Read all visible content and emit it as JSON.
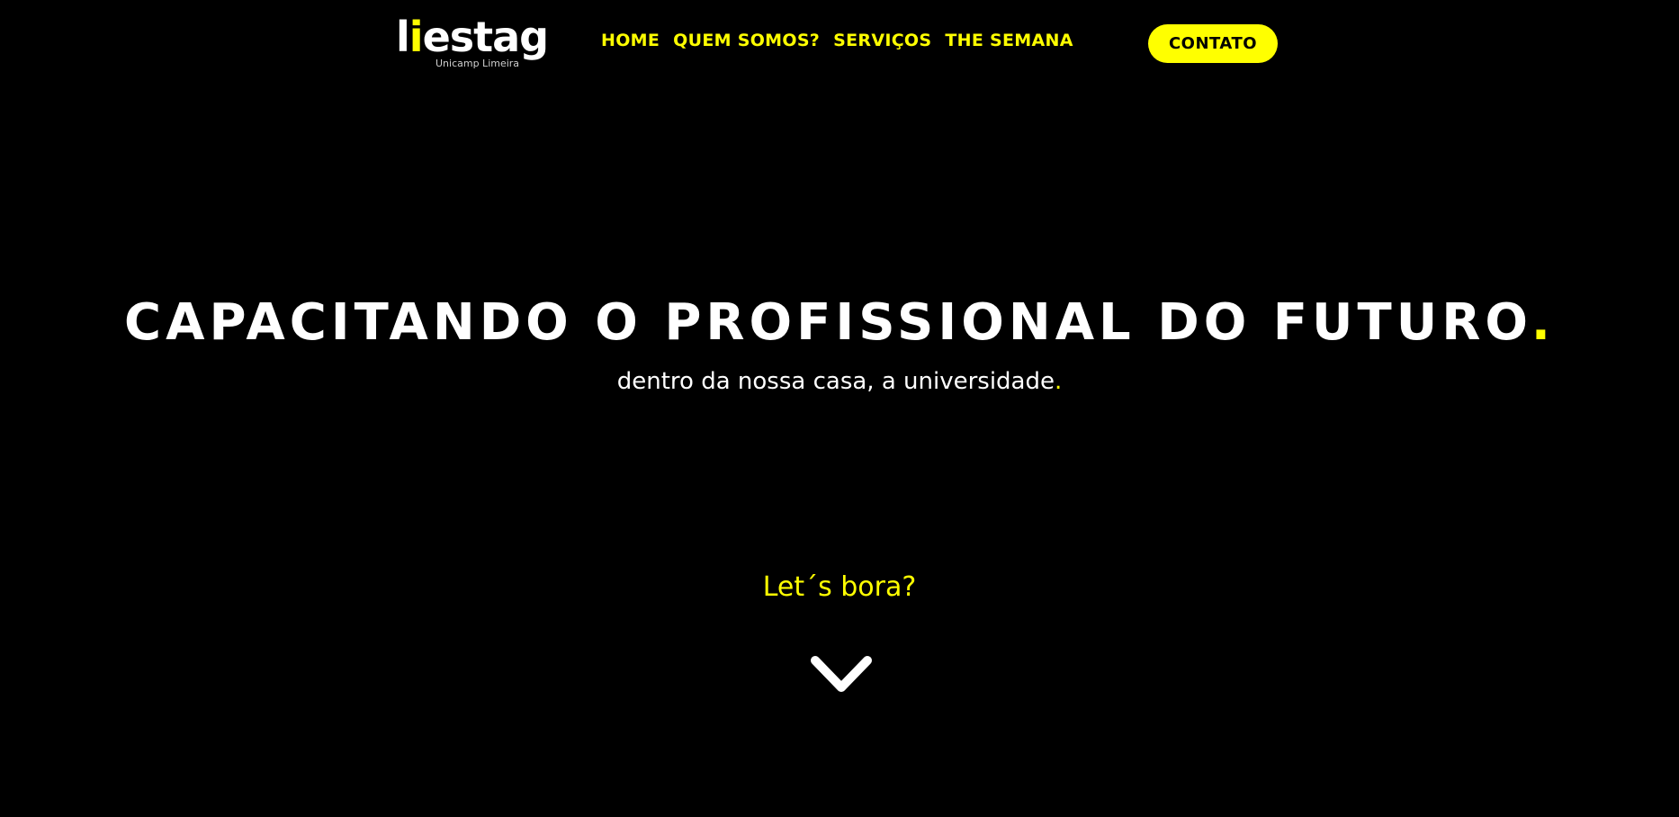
{
  "header": {
    "logo": {
      "text_part1": "l",
      "text_accent": "i",
      "text_part2": "estag",
      "subtitle": "Unicamp Limeira"
    },
    "nav": [
      {
        "label": "HOME"
      },
      {
        "label": "QUEM SOMOS?"
      },
      {
        "label": "SERVIÇOS"
      },
      {
        "label": "THE SEMANA"
      }
    ],
    "contact_label": "CONTATO"
  },
  "hero": {
    "title": "CAPACITANDO O PROFISSIONAL DO FUTURO",
    "title_dot": ".",
    "subtitle": "dentro da nossa casa, a universidade",
    "subtitle_dot": ".",
    "cta": "Let´s bora?",
    "scroll_icon": "chevron-down-icon"
  },
  "colors": {
    "background": "#000000",
    "accent": "#ffff00",
    "text": "#ffffff"
  }
}
